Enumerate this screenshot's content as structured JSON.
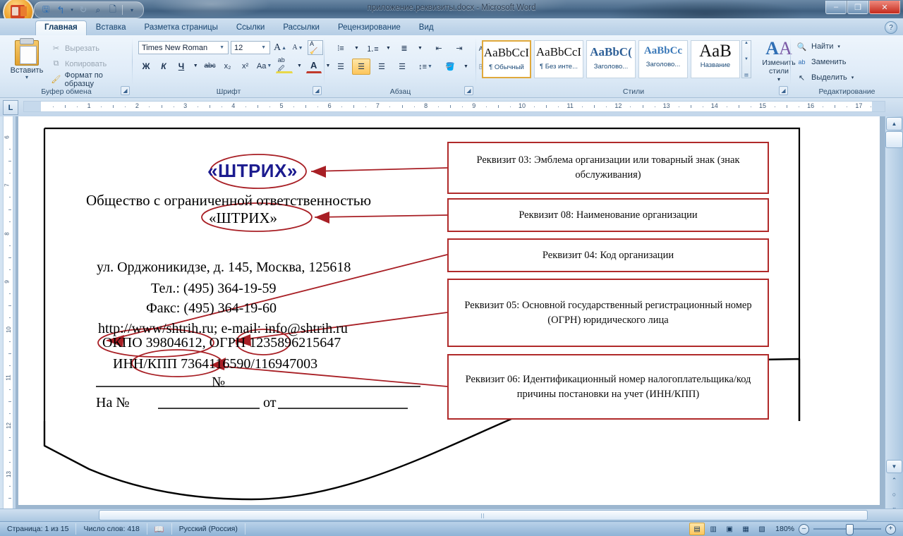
{
  "window": {
    "title": "приложение.реквизиты.docx - Microsoft Word",
    "minimize": "–",
    "maximize": "❐",
    "close": "✕",
    "help": "?"
  },
  "quick_access": {
    "office_button": "office-logo",
    "items": [
      {
        "name": "save-icon",
        "glyph": "💾"
      },
      {
        "name": "undo-icon",
        "glyph": "↰"
      },
      {
        "name": "undo-dropdown-icon",
        "glyph": "▾"
      },
      {
        "name": "redo-icon",
        "glyph": "↻"
      },
      {
        "name": "print-preview-icon",
        "glyph": "🔍"
      },
      {
        "name": "new-document-icon",
        "glyph": "🗋"
      }
    ],
    "customize": "▾"
  },
  "tabs": [
    {
      "label": "Главная",
      "active": true
    },
    {
      "label": "Вставка",
      "active": false
    },
    {
      "label": "Разметка страницы",
      "active": false
    },
    {
      "label": "Ссылки",
      "active": false
    },
    {
      "label": "Рассылки",
      "active": false
    },
    {
      "label": "Рецензирование",
      "active": false
    },
    {
      "label": "Вид",
      "active": false
    }
  ],
  "ribbon": {
    "clipboard": {
      "group_label": "Буфер обмена",
      "paste_label": "Вставить",
      "paste_caret": "▾",
      "cut": "Вырезать",
      "copy": "Копировать",
      "format_painter": "Формат по образцу",
      "dialog_launcher": "⌐"
    },
    "font": {
      "group_label": "Шрифт",
      "font_name": "Times New Roman",
      "font_size": "12",
      "grow_font": "A",
      "shrink_font": "A",
      "clear_formatting": "Aa",
      "bold": "Ж",
      "italic": "К",
      "underline": "Ч",
      "strikethrough": "abc",
      "subscript": "x₂",
      "superscript": "x²",
      "change_case": "Aa",
      "highlight": "ab",
      "font_color": "A",
      "dropdown": "▾",
      "dialog_launcher": "⌐"
    },
    "paragraph": {
      "group_label": "Абзац",
      "bullets": "≔",
      "numbering": "≕",
      "multilevel": "≡",
      "decrease_indent": "⇤",
      "increase_indent": "⇥",
      "sort": "A↓",
      "show_marks": "¶",
      "align_left": "≡",
      "align_center": "≡",
      "align_right": "≡",
      "justify": "≡",
      "line_spacing": "↕",
      "shading": "▧",
      "borders": "⊞",
      "dropdown": "▾",
      "dialog_launcher": "⌐"
    },
    "styles": {
      "group_label": "Стили",
      "gallery": [
        {
          "sample": "AaBbCcI",
          "sample_size": "17px",
          "sample_color": "#111111",
          "name": "¶ Обычный",
          "active": true
        },
        {
          "sample": "AaBbCcI",
          "sample_size": "17px",
          "sample_color": "#111111",
          "name": "¶ Без инте...",
          "active": false
        },
        {
          "sample": "AaBbC(",
          "sample_size": "17px",
          "sample_color": "#2d5f97",
          "name": "Заголово...",
          "active": false
        },
        {
          "sample": "AaBbCc",
          "sample_size": "15px",
          "sample_color": "#3a78b8",
          "name": "Заголово...",
          "active": false
        },
        {
          "sample": "AaB",
          "sample_size": "25px",
          "sample_color": "#111111",
          "name": "Название",
          "active": false
        }
      ],
      "scroll_up": "▲",
      "scroll_down": "▼",
      "more": "▤",
      "change_styles": "Изменить стили",
      "change_styles_caret": "▾",
      "dialog_launcher": "⌐"
    },
    "editing": {
      "group_label": "Редактирование",
      "find": "Найти",
      "replace": "Заменить",
      "select": "Выделить",
      "caret": "▾"
    }
  },
  "ruler": {
    "tab_selector": "L",
    "h_numbers": [
      1,
      2,
      3,
      4,
      5,
      6,
      7,
      8,
      9,
      10,
      11,
      12,
      13,
      14,
      15,
      16,
      17
    ],
    "v_numbers": [
      6,
      7,
      8,
      9,
      10,
      11,
      12,
      13
    ]
  },
  "document": {
    "logo": "«ШТРИХ»",
    "lines": [
      "Общество с ограниченной ответственностью",
      "«ШТРИХ»",
      "ул. Орджоникидзе, д. 145, Москва, 125618",
      "Тел.: (495) 364-19-59",
      "Факс:  (495) 364-19-60",
      "http://www/shtrih.ru; e-mail: info@shtrih.ru",
      "ОКПО 39804612, ОГРН 1235896215647",
      "ИНН/КПП 7364116590/116947003"
    ],
    "number_mark": "№",
    "reply_prefix": "На №",
    "reply_from": "от",
    "callouts": [
      "Реквизит 03: Эмблема организации или товарный знак (знак обслуживания)",
      "Реквизит 08: Наименование организации",
      "Реквизит 04: Код организации",
      "Реквизит 05: Основной государственный регистрационный номер (ОГРН) юридического лица",
      "Реквизит 06: Идентификационный номер налогоплательщика/код причины постановки на учет (ИНН/КПП)"
    ]
  },
  "colors": {
    "callout_border": "#b02a2a",
    "annotation_red": "#a81f25",
    "logo_blue": "#1b1b8f",
    "accent": "#fdc65c"
  },
  "status_bar": {
    "page": "Страница: 1 из 15",
    "words": "Число слов: 418",
    "proofing_icon": "proofing-errors-icon",
    "language": "Русский (Россия)",
    "views": [
      {
        "name": "print-layout-view",
        "glyph": "▤",
        "active": true
      },
      {
        "name": "full-screen-reading-view",
        "glyph": "▥",
        "active": false
      },
      {
        "name": "web-layout-view",
        "glyph": "▣",
        "active": false
      },
      {
        "name": "outline-view",
        "glyph": "▦",
        "active": false
      },
      {
        "name": "draft-view",
        "glyph": "▧",
        "active": false
      }
    ],
    "zoom": "180%",
    "zoom_out": "–",
    "zoom_in": "+"
  },
  "scrollbars": {
    "up": "▲",
    "down": "▼",
    "prev_page": "⌃",
    "select_browse_object": "○",
    "next_page": "⌄",
    "left": "◄",
    "right": "►"
  }
}
